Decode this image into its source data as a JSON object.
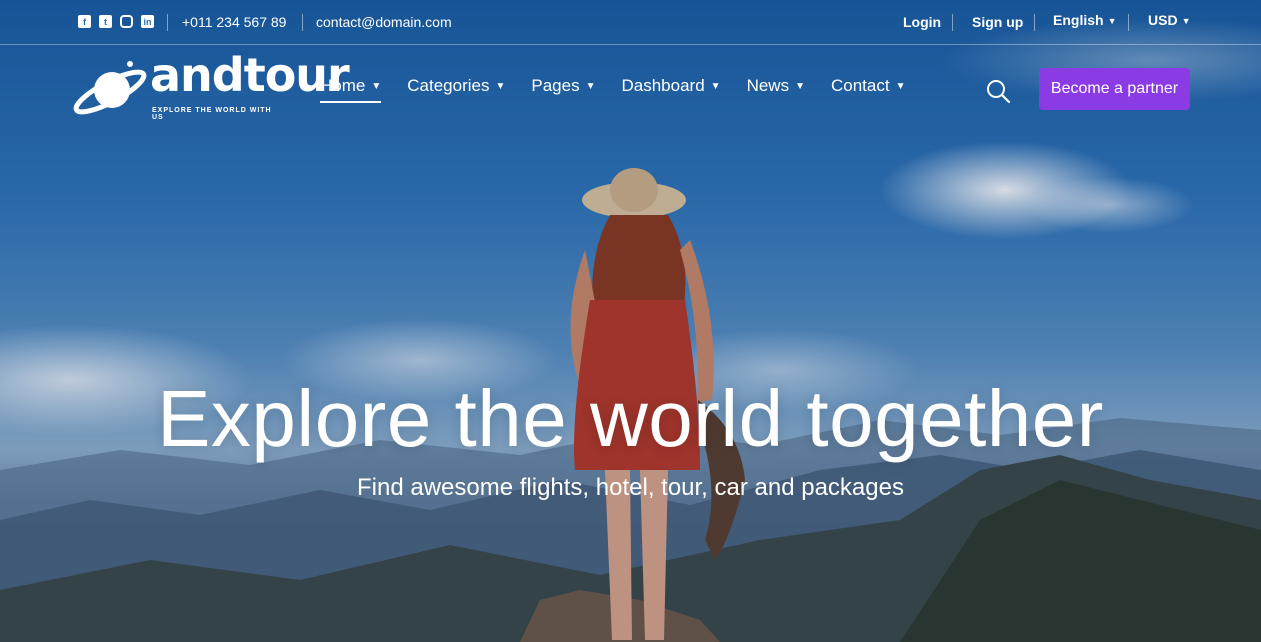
{
  "topbar": {
    "social_icons": [
      "facebook-icon",
      "twitter-icon",
      "instagram-icon",
      "linkedin-icon"
    ],
    "phone": "+011 234 567 89",
    "email": "contact@domain.com",
    "login": "Login",
    "signup": "Sign up",
    "language": "English",
    "currency": "USD"
  },
  "logo": {
    "wordmark": "andtour",
    "tagline": "EXPLORE THE WORLD WITH US"
  },
  "nav": {
    "items": [
      {
        "label": "Home",
        "active": true
      },
      {
        "label": "Categories"
      },
      {
        "label": "Pages"
      },
      {
        "label": "Dashboard"
      },
      {
        "label": "News"
      },
      {
        "label": "Contact"
      }
    ],
    "search_icon": "search-icon",
    "cta_label": "Become a partner"
  },
  "hero": {
    "title": "Explore the world together",
    "subtitle": "Find awesome flights, hotel, tour, car and packages"
  },
  "colors": {
    "accent": "#8b3be4",
    "sky": "#2f74b8"
  }
}
